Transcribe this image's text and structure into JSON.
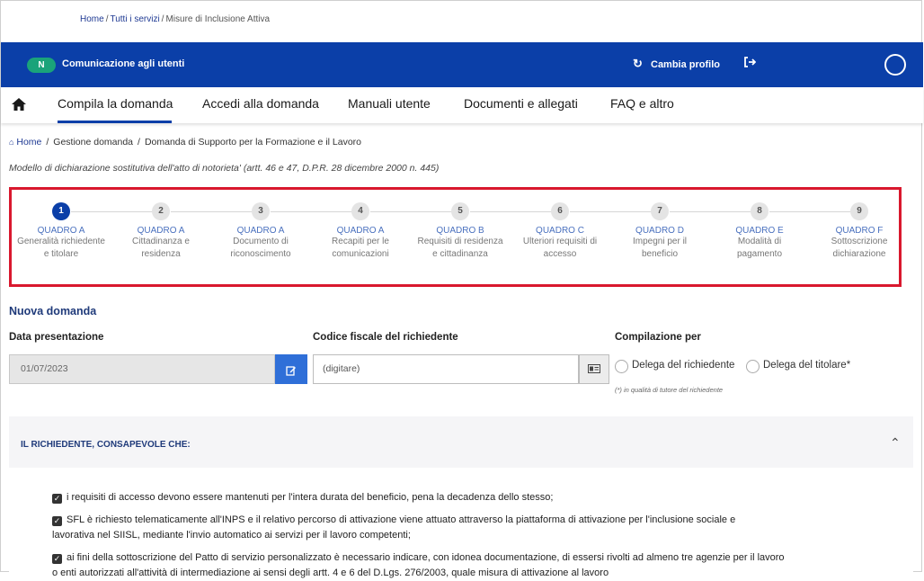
{
  "top_breadcrumb": {
    "home": "Home",
    "services": "Tutti i servizi",
    "current": "Misure di Inclusione Attiva"
  },
  "header": {
    "badge": "N",
    "communication_label": "Comunicazione agli utenti",
    "change_profile": "Cambia profilo",
    "colors": {
      "bar": "#0b3fa8",
      "badge": "#1aa37a"
    }
  },
  "nav": {
    "items": [
      {
        "label": "Compila la domanda"
      },
      {
        "label": "Accedi alla domanda"
      },
      {
        "label": "Manuali utente"
      },
      {
        "label": "Documenti e allegati"
      },
      {
        "label": "FAQ e altro"
      }
    ]
  },
  "breadcrumb": {
    "home": "Home",
    "level1": "Gestione domanda",
    "level2": "Domanda di Supporto per la Formazione e il Lavoro"
  },
  "model_line": "Modello di dichiarazione sostitutiva dell'atto di notorieta' (artt. 46 e 47, D.P.R. 28 dicembre 2000 n. 445)",
  "stepper": {
    "active_step": 1,
    "steps": [
      {
        "num": "1",
        "title": "QUADRO A",
        "line1": "Generalità richiedente",
        "line2": "e titolare"
      },
      {
        "num": "2",
        "title": "QUADRO A",
        "line1": "Cittadinanza e",
        "line2": "residenza"
      },
      {
        "num": "3",
        "title": "QUADRO A",
        "line1": "Documento di",
        "line2": "riconoscimento"
      },
      {
        "num": "4",
        "title": "QUADRO A",
        "line1": "Recapiti per le",
        "line2": "comunicazioni"
      },
      {
        "num": "5",
        "title": "QUADRO B",
        "line1": "Requisiti di residenza",
        "line2": "e cittadinanza"
      },
      {
        "num": "6",
        "title": "QUADRO C",
        "line1": "Ulteriori requisiti di",
        "line2": "accesso"
      },
      {
        "num": "7",
        "title": "QUADRO D",
        "line1": "Impegni per il",
        "line2": "beneficio"
      },
      {
        "num": "8",
        "title": "QUADRO E",
        "line1": "Modalità di",
        "line2": "pagamento"
      },
      {
        "num": "9",
        "title": "QUADRO F",
        "line1": "Sottoscrizione",
        "line2": "dichiarazione"
      }
    ]
  },
  "form": {
    "section_title": "Nuova domanda",
    "date_label": "Data presentazione",
    "date_value": "01/07/2023",
    "cf_label": "Codice fiscale del richiedente",
    "cf_placeholder": "(digitare)",
    "compilazione_label": "Compilazione per",
    "radio1": "Delega del richiedente",
    "radio2": "Delega del titolare*",
    "note": "(*) in qualità di tutore del richiedente"
  },
  "accordion": {
    "title": "IL RICHIEDENTE, CONSAPEVOLE CHE:",
    "items": [
      {
        "line1": "i requisiti di accesso devono essere mantenuti per l'intera durata del beneficio, pena la decadenza dello stesso;",
        "line2": ""
      },
      {
        "line1": "SFL è richiesto telematicamente all'INPS e il relativo percorso di attivazione viene attuato attraverso la piattaforma di attivazione per l'inclusione sociale e",
        "line2": "lavorativa nel SIISL, mediante l'invio automatico ai servizi per il lavoro competenti;"
      },
      {
        "line1": "ai fini della sottoscrizione del Patto di servizio personalizzato è necessario indicare, con idonea documentazione, di essersi rivolti ad almeno tre agenzie per il lavoro",
        "line2": "o enti autorizzati all'attività di intermediazione ai sensi degli artt. 4 e 6 del D.Lgs. 276/2003, quale misura di attivazione al lavoro"
      }
    ]
  }
}
